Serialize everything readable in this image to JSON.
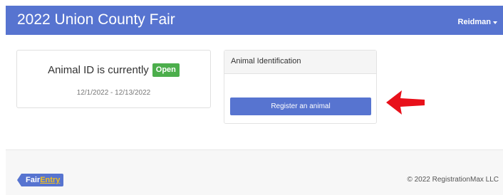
{
  "header": {
    "title": "2022 Union County Fair",
    "user_label": "Reidman"
  },
  "status_card": {
    "prefix": "Animal ID is currently",
    "status": "Open",
    "date_range": "12/1/2022 - 12/13/2022"
  },
  "panel": {
    "heading": "Animal Identification",
    "register_button_label": "Register an animal"
  },
  "footer": {
    "logo_part1": "Fair",
    "logo_part2": "Entry",
    "copyright": "© 2022 RegistrationMax LLC"
  },
  "colors": {
    "navbar": "#5774d0",
    "open_badge": "#4cae4c",
    "arrow": "#e8101a",
    "logo_entry": "#f0c020"
  },
  "icons": {
    "user_menu": "caret-down-icon",
    "annotation": "red-arrow-icon"
  }
}
